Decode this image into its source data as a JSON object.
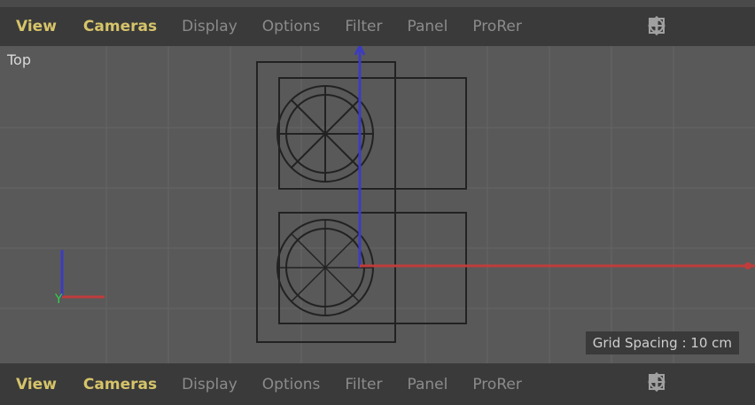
{
  "menu": {
    "view": "View",
    "cameras": "Cameras",
    "display": "Display",
    "options": "Options",
    "filter": "Filter",
    "panel": "Panel",
    "prorender": "ProRer"
  },
  "viewport": {
    "label": "Top",
    "grid_spacing": "Grid Spacing : 10 cm"
  },
  "icons": {
    "move": "move-icon",
    "zoom": "zoom-icon",
    "rotate": "rotate-icon",
    "maximize": "maximize-icon"
  },
  "colors": {
    "active_menu": "#d6c46a",
    "y_axis": "#3c3cc0",
    "x_axis": "#c03c3c",
    "axis_label_y": "#2fd24a"
  }
}
